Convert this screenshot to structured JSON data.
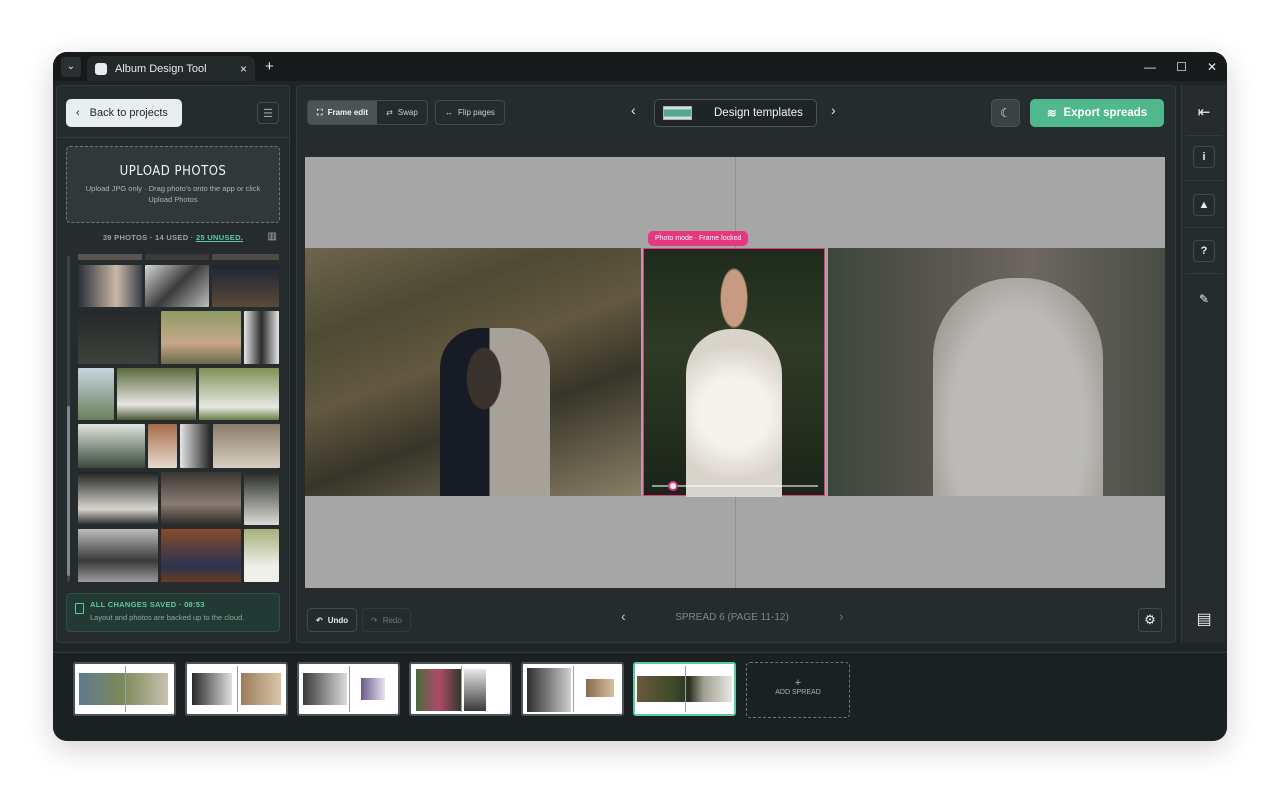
{
  "window": {
    "tab_title": "Album Design Tool",
    "tab_close": "×",
    "new_tab": "+",
    "minimize": "—",
    "maximize": "☐",
    "close": "✕",
    "menu": "⌄"
  },
  "sidebar": {
    "back_label": "Back to projects",
    "upload_title": "UPLOAD PHOTOS",
    "upload_sub": "Upload JPG only · Drag photo's onto the app or click Upload Photos",
    "stats_prefix": "39 PHOTOS · 14 USED · ",
    "stats_unused": "25 UNUSED.",
    "saved_title": "ALL CHANGES SAVED · 08:53",
    "saved_sub": "Layout and photos are backed up to the cloud."
  },
  "toolbar": {
    "frame_edit": "Frame edit",
    "swap": "Swap",
    "flip_pages": "Flip pages",
    "templates_label": "Design templates",
    "export_label": "Export spreads"
  },
  "canvas": {
    "lock_tag": "Photo mode · Frame locked"
  },
  "footer": {
    "undo": "Undo",
    "redo": "Redo",
    "spread_label": "SPREAD 6 (PAGE 11-12)"
  },
  "filmstrip": {
    "add_spread": "ADD SPREAD",
    "add_plus": "+",
    "active_index": 5
  },
  "colors": {
    "accent": "#4fb88c",
    "selection": "#e5387e",
    "saved": "#5fc9a2"
  },
  "icons": [
    "chevron-left-icon",
    "filter-icon",
    "grid-icon",
    "frame-icon",
    "swap-icon",
    "flip-icon",
    "moon-icon",
    "layers-icon",
    "collapse-icon",
    "info-icon",
    "image-icon",
    "help-icon",
    "feedback-icon",
    "settings-icon",
    "save-icon",
    "book-icon"
  ]
}
